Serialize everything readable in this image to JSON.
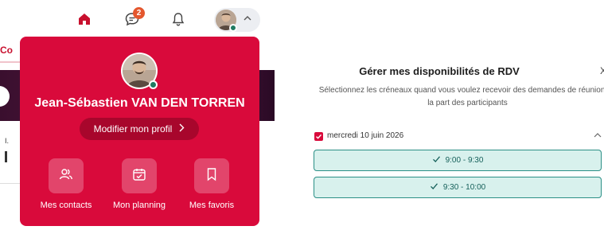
{
  "header": {
    "notification_count": "2",
    "icons": [
      "home-icon",
      "chat-icon",
      "bell-icon",
      "avatar",
      "chevron-up-icon"
    ]
  },
  "background": {
    "tab_fragment": "Co",
    "text_fragment": "I."
  },
  "profile_menu": {
    "name": "Jean-Sébastien VAN DEN TORREN",
    "edit_profile_label": "Modifier mon profil",
    "shortcuts": [
      {
        "label": "Mes contacts",
        "icon": "contacts-icon"
      },
      {
        "label": "Mon planning",
        "icon": "calendar-check-icon"
      },
      {
        "label": "Mes favoris",
        "icon": "bookmark-icon"
      }
    ],
    "accent_color": "#d90a3b",
    "status_color": "#1f7a62"
  },
  "availability": {
    "title": "Gérer mes disponibilités de RDV",
    "close_symbol": "X",
    "subtitle": "Sélectionnez les créneaux quand vous voulez recevoir des demandes de réunion de la part des participants",
    "day": {
      "label": "mercredi 10 juin 2026",
      "checked": true,
      "slots": [
        "9:00 - 9:30",
        "9:30 - 10:00"
      ]
    },
    "slot_color": "#d8f1ed"
  }
}
